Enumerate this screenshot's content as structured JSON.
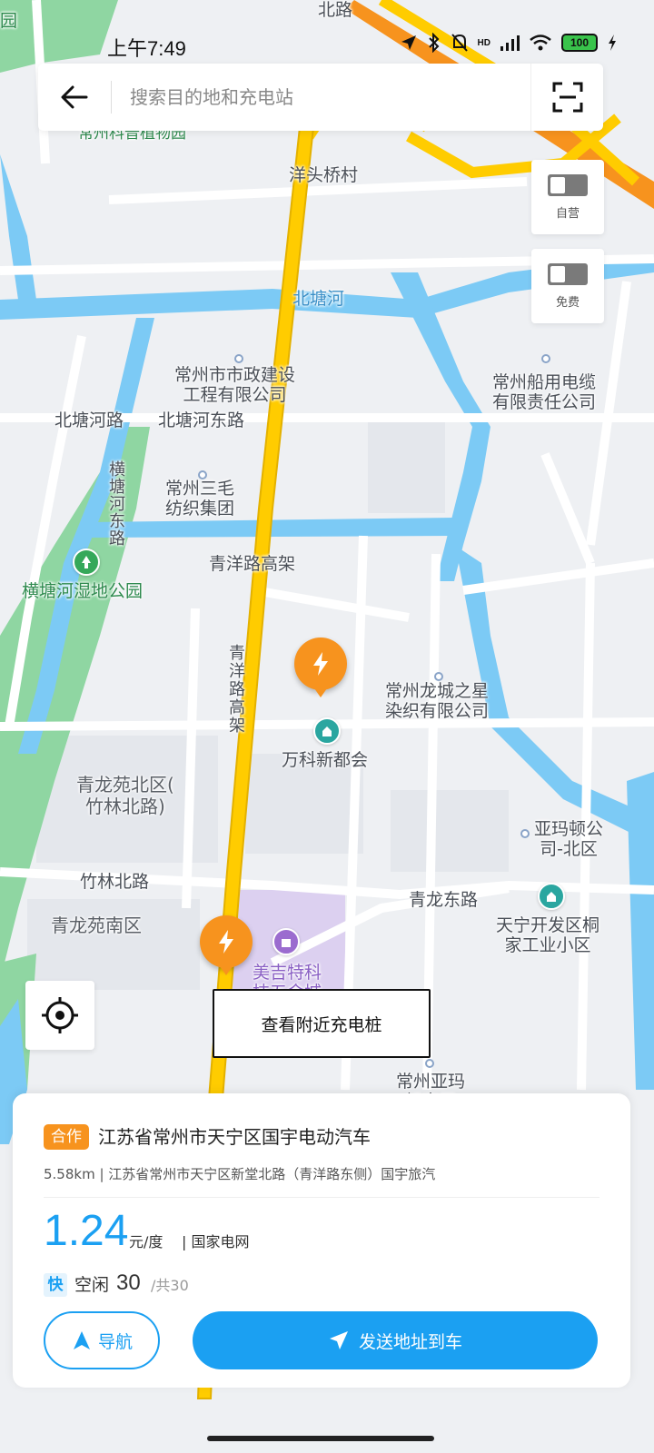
{
  "status_bar": {
    "time": "上午7:49",
    "network": "HD",
    "battery": "100",
    "icons": [
      "location-icon",
      "bluetooth-icon",
      "mute-icon",
      "signal-icon",
      "wifi-icon",
      "battery-icon",
      "charging-icon"
    ]
  },
  "search": {
    "placeholder": "搜索目的地和充电站"
  },
  "toggles": [
    {
      "label": "自营",
      "on": false
    },
    {
      "label": "免费",
      "on": false
    }
  ],
  "map": {
    "labels": {
      "yangtou": "洋头桥村",
      "beitang_he": "北塘河",
      "shizheng": "常州市市政建设\n工程有限公司",
      "chuanyong": "常州船用电缆\n有限责任公司",
      "beitanghe_lu": "北塘河路",
      "beitanghe_donglu": "北塘河东路",
      "sanmao": "常州三毛\n纺织集团",
      "hengtang_donglu": "横\n塘\n河\n东\n路",
      "hengtang_park": "横塘河湿地公园",
      "qingyang_viaduct": "青洋路高架",
      "qingyang_viaduct_v": "青\n洋\n路\n高\n架",
      "longcheng": "常州龙城之星\n染织有限公司",
      "vanke": "万科新都会",
      "qinglong_north": "青龙苑北区(\n竹林北路)",
      "yamadun": "亚玛顿公\n司-北区",
      "zhulin_beilu": "竹林北路",
      "qinglong_donglu": "青龙东路",
      "qinglong_south": "青龙苑南区",
      "tianning": "天宁开发区桐\n家工业小区",
      "meiji": "美吉特科\n技五金城",
      "changzhou_yama": "常州亚玛\n顿南区",
      "top_park": "常州科普植物园",
      "top_road": "北路",
      "corner": "园"
    }
  },
  "actions": {
    "nearby": "查看附近充电桩"
  },
  "station": {
    "badge": "合作",
    "name": "江苏省常州市天宁区国宇电动汽车",
    "meta": "5.58km | 江苏省常州市天宁区新堂北路（青洋路东侧）国宇旅汽",
    "price": "1.24",
    "price_unit": "元/度",
    "provider": "| 国家电网",
    "fast_tag": "快",
    "idle_label": "空闲",
    "idle_count": "30",
    "total": "/共30",
    "navigate": "导航",
    "send": "发送地址到车"
  },
  "colors": {
    "accent": "#1ba0f2",
    "pin": "#f7931e",
    "highway": "#ffcc00",
    "water": "#7ccaf5",
    "park": "#8fd6a2"
  }
}
